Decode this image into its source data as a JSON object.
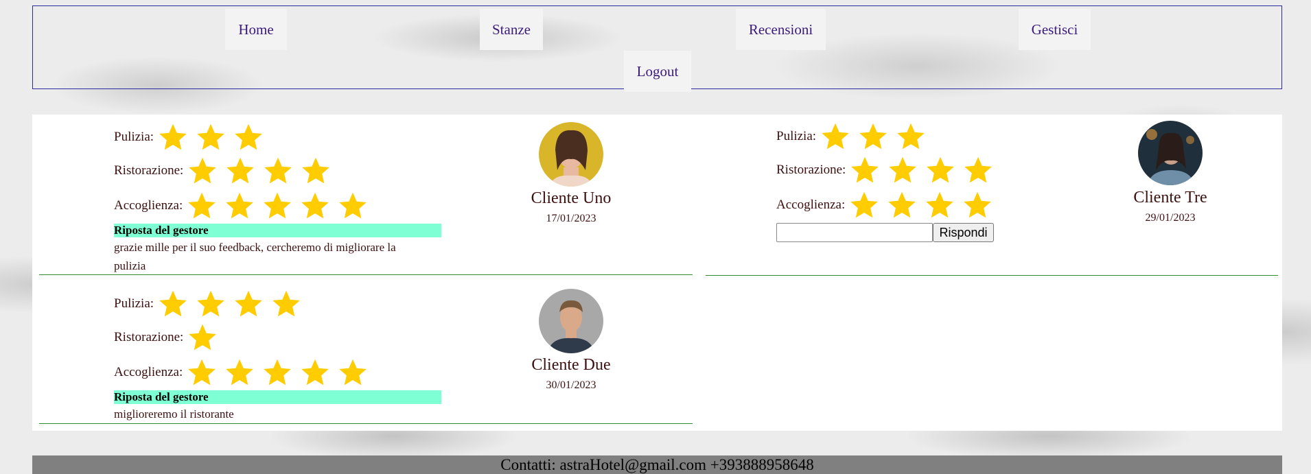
{
  "nav": {
    "items": [
      {
        "label": "Home"
      },
      {
        "label": "Stanze"
      },
      {
        "label": "Recensioni"
      },
      {
        "label": "Gestisci"
      },
      {
        "label": "Logout"
      }
    ]
  },
  "reviews": [
    {
      "client_name": "Cliente Uno",
      "date": "17/01/2023",
      "ratings": [
        {
          "label": "Pulizia:",
          "stars": 3
        },
        {
          "label": "Ristorazione:",
          "stars": 4
        },
        {
          "label": "Accoglienza:",
          "stars": 5
        }
      ],
      "reply_heading": "Riposta del gestore",
      "reply_text": "grazie mille per il suo feedback, cercheremo di migliorare la pulizia"
    },
    {
      "client_name": "Cliente Tre",
      "date": "29/01/2023",
      "ratings": [
        {
          "label": "Pulizia:",
          "stars": 3
        },
        {
          "label": "Ristorazione:",
          "stars": 4
        },
        {
          "label": "Accoglienza:",
          "stars": 4
        }
      ],
      "reply_input_value": "",
      "reply_button_label": "Rispondi"
    },
    {
      "client_name": "Cliente Due",
      "date": "30/01/2023",
      "ratings": [
        {
          "label": "Pulizia:",
          "stars": 4
        },
        {
          "label": "Ristorazione:",
          "stars": 1
        },
        {
          "label": "Accoglienza:",
          "stars": 5
        }
      ],
      "reply_heading": "Riposta del gestore",
      "reply_text": "miglioreremo il ristorante"
    }
  ],
  "footer": {
    "text": "Contatti: astraHotel@gmail.com +393888958648"
  },
  "colors": {
    "star": "#ffcc00",
    "nav_text": "#3a1a7a",
    "reply_highlight": "#7fffd4",
    "divider": "#2e8b2e",
    "footer_bg": "#808080"
  },
  "icons": {
    "rating": "star-icon"
  }
}
